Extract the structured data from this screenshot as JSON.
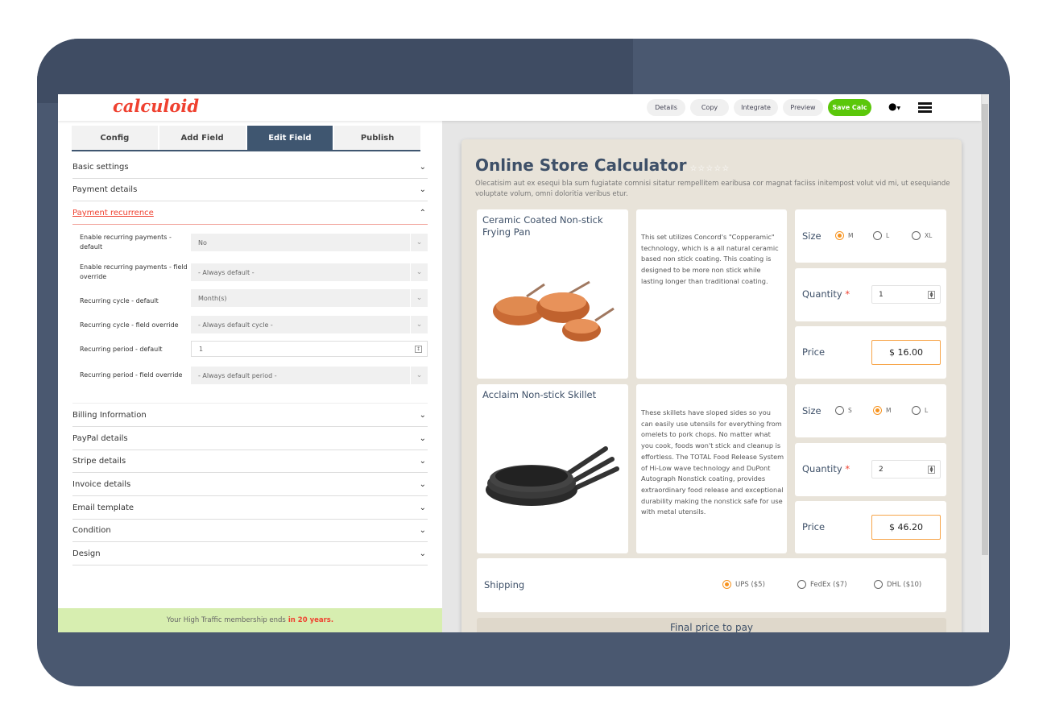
{
  "app": {
    "logo": "calculoid"
  },
  "toolbar": {
    "details": "Details",
    "copy": "Copy",
    "integrate": "Integrate",
    "preview": "Preview",
    "save": "Save Calc"
  },
  "tabs": [
    "Config",
    "Add Field",
    "Edit Field",
    "Publish"
  ],
  "active_tab": "Edit Field",
  "sections_top": [
    "Basic settings",
    "Payment details",
    "Payment recurrence"
  ],
  "recurrence_fields": [
    {
      "label": "Enable recurring payments - default",
      "value": "No"
    },
    {
      "label": "Enable recurring payments - field override",
      "value": "- Always default -"
    },
    {
      "label": "Recurring cycle - default",
      "value": "Month(s)"
    },
    {
      "label": "Recurring cycle - field override",
      "value": "- Always default cycle -"
    },
    {
      "label": "Recurring period - default",
      "value": "1"
    },
    {
      "label": "Recurring period - field override",
      "value": "- Always default period -"
    }
  ],
  "sections_bottom": [
    "Billing Information",
    "PayPal details",
    "Stripe details",
    "Invoice details",
    "Email template",
    "Condition",
    "Design"
  ],
  "notice": {
    "text": "Your High Traffic membership ends",
    "highlight": "in 20 years."
  },
  "calculator": {
    "title": "Online Store Calculator",
    "rating": 0,
    "description": "Olecatisim aut ex esequi bla sum fugiatate comnisi sitatur rempellitem earibusa cor magnat faciiss initempost volut vid mi, ut esequiande voluptate volum, omni doloritia veribus etur.",
    "products": [
      {
        "name": "Ceramic Coated Non-stick Frying Pan",
        "text": "This set utilizes Concord's \"Copperamic\" technology, which is a all natural ceramic based non stick coating. This coating is designed to be more non stick while lasting longer than traditional coating.",
        "size_label": "Size",
        "sizes": [
          "M",
          "L",
          "XL"
        ],
        "selected_size": "M",
        "quantity_label": "Quantity",
        "quantity": "1",
        "price_label": "Price",
        "price": "$ 16.00"
      },
      {
        "name": "Acclaim Non-stick Skillet",
        "text": "These skillets have sloped sides so you can easily use utensils for everything from omelets to pork chops. No matter what you cook, foods won't stick and cleanup is effortless. The TOTAL Food Release System of Hi-Low wave technology and DuPont Autograph Nonstick coating, provides extraordinary food release and exceptional durability making the nonstick safe for use with metal utensils.",
        "size_label": "Size",
        "sizes": [
          "S",
          "M",
          "L"
        ],
        "selected_size": "M",
        "quantity_label": "Quantity",
        "quantity": "2",
        "price_label": "Price",
        "price": "$ 46.20"
      }
    ],
    "shipping": {
      "label": "Shipping",
      "options": [
        "UPS ($5)",
        "FedEx ($7)",
        "DHL ($10)"
      ],
      "selected": "UPS ($5)"
    },
    "final_label": "Final price to pay"
  },
  "colors": {
    "accent": "#ef4130",
    "tab_active": "#3f5670",
    "save": "#5bc70a",
    "radio": "#f7931e",
    "frame": "#4a5870"
  }
}
